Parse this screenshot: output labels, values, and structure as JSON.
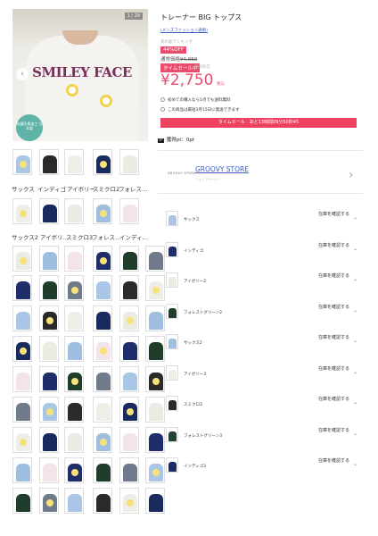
{
  "gallery": {
    "counter": "1 / 29",
    "prev_icon": "chevron-left-icon",
    "badge_text": "抗菌防臭加工 日本製",
    "hero_logo": "SMILEY FACE",
    "row1_labels": [
      "サックス",
      "インディゴ",
      "アイボリー",
      "スミクロ2",
      "フォレス…"
    ],
    "row2_labels": [
      "サックス2",
      "アイボリ…",
      "スミクロ3",
      "フォレス…",
      "インディ…"
    ]
  },
  "product": {
    "title": "トレーナー BIG トップス",
    "category_link": "(メンズファッション通販)",
    "small_note": "売れ筋ランキング",
    "off_badge": "44%OFF",
    "regular_label": "通常価格",
    "regular_price": "¥4,950",
    "sale_badge": "タイムセール中",
    "sale_sub": "価格改定",
    "price": "¥2,750",
    "tax_label": "税込",
    "info1": "初めての購入なら1点でも送料無料",
    "info2": "この商品は最短3月15日に発送できます",
    "timesale_text": "タイムセール　あと13時間09分50秒45",
    "points": "獲得pt：0pt",
    "points_mark": "P"
  },
  "store": {
    "logo_text": "GROOVY STORE",
    "name": "GROOVY STORE",
    "sub": "ショップページへ",
    "arrow_icon": "chevron-right-icon"
  },
  "variants": [
    {
      "name": "サックス",
      "stock": "在庫を確認する",
      "color": "#a9c6e6"
    },
    {
      "name": "インディゴ",
      "stock": "在庫を確認する",
      "color": "#1f2d6b"
    },
    {
      "name": "アイボリー2",
      "stock": "在庫を確認する",
      "color": "#ecebe3"
    },
    {
      "name": "フォレストグリーン2",
      "stock": "在庫を確認する",
      "color": "#1f3d2a"
    },
    {
      "name": "サックス2",
      "stock": "在庫を確認する",
      "color": "#9fbfe0"
    },
    {
      "name": "アイボリー3",
      "stock": "在庫を確認する",
      "color": "#efeee6"
    },
    {
      "name": "スミクロ3",
      "stock": "在庫を確認する",
      "color": "#2a2a2a"
    },
    {
      "name": "フォレストグリーン3",
      "stock": "在庫を確認する",
      "color": "#234330"
    },
    {
      "name": "インディゴ3",
      "stock": "在庫を確認する",
      "color": "#1c2a66"
    }
  ],
  "colors": {
    "accent": "#e94d6d",
    "link": "#3a5bbf"
  }
}
